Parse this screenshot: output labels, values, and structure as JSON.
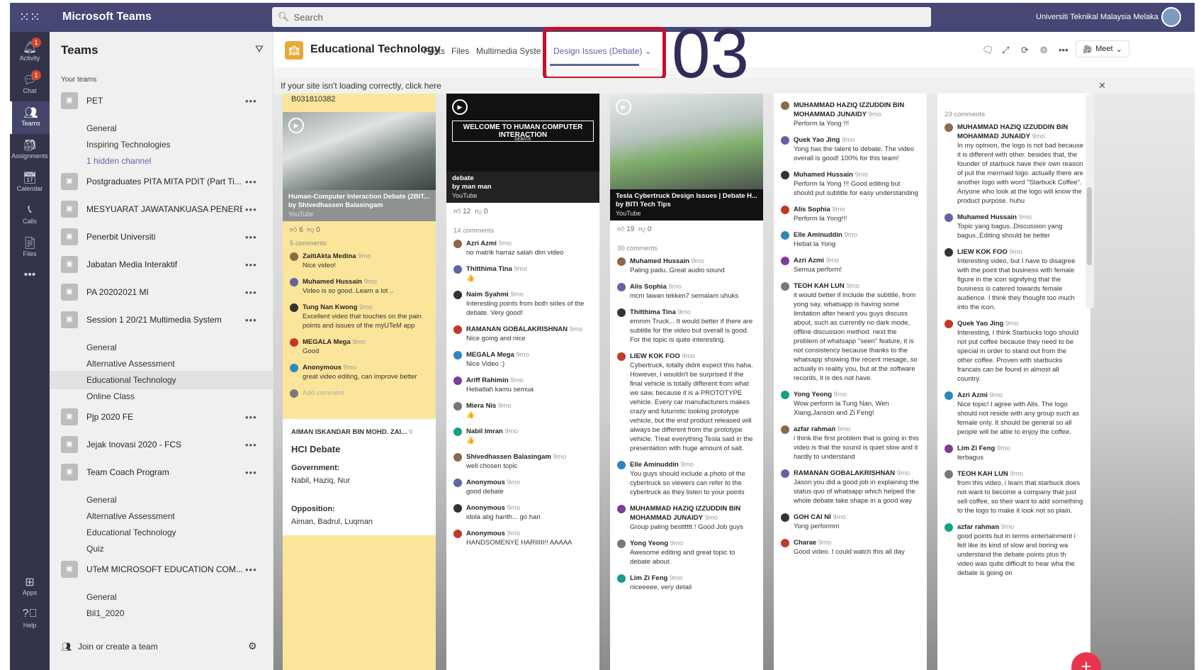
{
  "app": {
    "title": "Microsoft Teams",
    "org": "Universiti Teknikal Malaysia Melaka",
    "search_placeholder": "Search"
  },
  "rail": [
    {
      "label": "Activity",
      "badge": "1"
    },
    {
      "label": "Chat",
      "badge": "1"
    },
    {
      "label": "Teams",
      "badge": ""
    },
    {
      "label": "Assignments",
      "badge": ""
    },
    {
      "label": "Calendar",
      "badge": ""
    },
    {
      "label": "Calls",
      "badge": ""
    },
    {
      "label": "Files",
      "badge": ""
    },
    {
      "label": "Apps",
      "badge": ""
    },
    {
      "label": "Help",
      "badge": ""
    }
  ],
  "teams": {
    "header": "Teams",
    "your_teams": "Your teams",
    "join": "Join or create a team",
    "items": [
      {
        "name": "PET",
        "type": "team"
      },
      {
        "name": "General",
        "type": "channel"
      },
      {
        "name": "Inspiring Technologies",
        "type": "channel"
      },
      {
        "name": "1 hidden channel",
        "type": "hidden"
      },
      {
        "name": "Postgraduates PITA MITA PDIT (Part Ti...",
        "type": "team"
      },
      {
        "name": "MESYUARAT JAWATANKUASA PENERB...",
        "type": "team"
      },
      {
        "name": "Penerbit Universiti",
        "type": "team"
      },
      {
        "name": "Jabatan Media Interaktif",
        "type": "team"
      },
      {
        "name": "PA 20202021 MI",
        "type": "team"
      },
      {
        "name": "Session 1 20/21 Multimedia System",
        "type": "team"
      },
      {
        "name": "General",
        "type": "channel"
      },
      {
        "name": "Alternative Assessment",
        "type": "channel"
      },
      {
        "name": "Educational Technology",
        "type": "channel"
      },
      {
        "name": "Online Class",
        "type": "channel"
      },
      {
        "name": "Pjp 2020 FE",
        "type": "team"
      },
      {
        "name": "Jejak Inovasi 2020 - FCS",
        "type": "team"
      },
      {
        "name": "Team Coach Program",
        "type": "team"
      },
      {
        "name": "General",
        "type": "channel"
      },
      {
        "name": "Alternative Assessment",
        "type": "channel"
      },
      {
        "name": "Educational Technology",
        "type": "channel"
      },
      {
        "name": "Quiz",
        "type": "channel"
      },
      {
        "name": "UTeM MICROSOFT EDUCATION COM...",
        "type": "team"
      },
      {
        "name": "General",
        "type": "channel"
      },
      {
        "name": "Bil1_2020",
        "type": "channel"
      }
    ]
  },
  "channel": {
    "name": "Educational Technology",
    "tabs": [
      "Posts",
      "Files",
      "Multimedia Syste",
      "Design Issues (Debate)"
    ],
    "annotation": "03",
    "meet": "Meet",
    "notice": "If your site isn't loading correctly, click here"
  },
  "board": {
    "col1": {
      "top_text": "B031810382",
      "video_title": "Human-Computer Interaction Debate (2BIT...",
      "video_by": "by Shivedhassen Balasingam",
      "video_src": "YouTube",
      "likes": "6",
      "dislikes": "0",
      "comments_count": "5 comments",
      "comments": [
        {
          "name": "ZaitiAkta Medina",
          "time": "9mo",
          "text": "Nice video!"
        },
        {
          "name": "Muhamed Hussain",
          "time": "9mo",
          "text": "Video is so good..Learn a lot .."
        },
        {
          "name": "Tung Nan Kwong",
          "time": "9mo",
          "text": "Excellent video that touches on the pain points and issues of the myUTeM app"
        },
        {
          "name": "MEGALA Mega",
          "time": "9mo",
          "text": "Good"
        },
        {
          "name": "Anonymous",
          "time": "9mo",
          "text": "great video editing, can improve better"
        }
      ],
      "add_comment": "Add comment",
      "card_author": "AIMAN ISKANDAR BIN MOHD. ZAI...",
      "card_time": "9",
      "card_title": "HCI Debate",
      "gov_label": "Government:",
      "gov": "Nabil, Haziq, Nur",
      "opp_label": "Opposition:",
      "opp": "Aiman, Badrul, Luqman"
    },
    "col2": {
      "video_banner": "WELCOME TO HUMAN COMPUTER INTERACTION",
      "video_banner_sub": "DEBATE",
      "video_title": "debate",
      "video_by": "by man man",
      "video_src": "YouTube",
      "likes": "12",
      "dislikes": "0",
      "comments_count": "14 comments",
      "comments": [
        {
          "name": "Azri Azmi",
          "time": "9mo",
          "text": "no matrik harraz salah dlm video"
        },
        {
          "name": "Thitthima Tina",
          "time": "9mo",
          "text": "👍"
        },
        {
          "name": "Naim Syahmi",
          "time": "9mo",
          "text": "Interesting points from both sides of the debate. Very good!"
        },
        {
          "name": "RAMANAN GOBALAKRISHNAN",
          "time": "9mo",
          "text": "Nice going and nice"
        },
        {
          "name": "MEGALA Mega",
          "time": "9mo",
          "text": "Nice Video :)"
        },
        {
          "name": "Ariff Rahimin",
          "time": "9mo",
          "text": "Hebatlah kamu semua"
        },
        {
          "name": "Miera Nis",
          "time": "9mo",
          "text": "👍"
        },
        {
          "name": "Nabil Imran",
          "time": "9mo",
          "text": "👍"
        },
        {
          "name": "Shivedhassen Balasingam",
          "time": "9mo",
          "text": "well chosen topic"
        },
        {
          "name": "Anonymous",
          "time": "9mo",
          "text": "good debate"
        },
        {
          "name": "Anonymous",
          "time": "9mo",
          "text": "idola abg harith... go hari"
        },
        {
          "name": "Anonymous",
          "time": "9mo",
          "text": "HANDSOMENYE HARIIIII!! AAAAA"
        }
      ]
    },
    "col3": {
      "video_title": "Tesla Cybertruck Design Issues | Debate H...",
      "video_by": "by BITI Tech Tips",
      "video_src": "YouTube",
      "likes": "19",
      "dislikes": "0",
      "comments_count": "30 comments",
      "comments": [
        {
          "name": "Muhamed Hussain",
          "time": "9mo",
          "text": "Paling padu..Great audio sound"
        },
        {
          "name": "Alis Sophia",
          "time": "9mo",
          "text": "mcm lawan tekken7 semalam uhuks"
        },
        {
          "name": "Thitthima Tina",
          "time": "9mo",
          "text": "emmm Truck... It would better if there are subtitle for the video but overall is good. For the topic is quite interesting."
        },
        {
          "name": "LIEW KOK FOO",
          "time": "9mo",
          "text": "Cybertruck, totally didnt expect this haha. However, I wouldn't be surprised if the final vehicle is totally different from what we saw, because it is a PROTOTYPE vehicle. Every car manufacturers makes crazy and futuristic looking prototype vehicle, but the end product released will always be different from the prototype vehicle. Treat everything Tesla said in the presentation with huge amount of salt."
        },
        {
          "name": "Elle Aminuddin",
          "time": "9mo",
          "text": "You guys should include a photo of the cybertruck so viewers can refer to the cybertruck as they listen to your points"
        },
        {
          "name": "MUHAMMAD HAZIQ IZZUDDIN BIN MOHAMMAD JUNAIDY",
          "time": "9mo",
          "text": "Group paling bestttttt ! Good Job guys"
        },
        {
          "name": "Yong Yeong",
          "time": "9mo",
          "text": "Awesome editing and great topic to debate about."
        },
        {
          "name": "Lim Zi Feng",
          "time": "9mo",
          "text": "niceeeee, very detail"
        }
      ]
    },
    "col4": {
      "comments": [
        {
          "name": "MUHAMMAD HAZIQ IZZUDDIN BIN MOHAMMAD JUNAIDY",
          "time": "9mo",
          "text": "Perform la Yong !!!"
        },
        {
          "name": "Quek Yao Jing",
          "time": "9mo",
          "text": "Yong has the talent to debate. The video overall is good! 100% for this team!"
        },
        {
          "name": "Muhamed Hussain",
          "time": "9mo",
          "text": "Perform la Yong !!! Good editing but should put subtitle for easy understanding"
        },
        {
          "name": "Alis Sophia",
          "time": "9mo",
          "text": "Perform la Yong!!!"
        },
        {
          "name": "Elle Aminuddin",
          "time": "9mo",
          "text": "Hebat la Yong"
        },
        {
          "name": "Azri Azmi",
          "time": "9mo",
          "text": "Semua perform!"
        },
        {
          "name": "TEOH KAH LUN",
          "time": "9mo",
          "text": "it would better if include the subtitle, from yong say, whatsapp is having some limitation after heard you guys discuss about, such as currently no dark mode, offline discussion method. next the problem of whatsapp \"seen\" feature, it is not consistency because thanks to the whatsapp showing the recent mesage, so actually in reality you, but at the software records, it is des not have."
        },
        {
          "name": "Yong Yeong",
          "time": "9mo",
          "text": "Wow perform la Tung Nan, Wen Xiang,Janson and Zi Feng!"
        },
        {
          "name": "azfar rahman",
          "time": "9mo",
          "text": "i think the first problem that is going in this video is that the sound is quiet slow and it hardly to understand"
        },
        {
          "name": "RAMANAN GOBALAKRISHNAN",
          "time": "9mo",
          "text": "Jason you did a good job in explaining the status quo of whatsapp which helped the whole debate take shape in a good way"
        },
        {
          "name": "GOH CAI NI",
          "time": "9mo",
          "text": "Yong performm"
        },
        {
          "name": "Charae",
          "time": "9mo",
          "text": "Good video. I could watch this all day"
        }
      ]
    },
    "col5": {
      "comments_count": "23 comments",
      "comments": [
        {
          "name": "MUHAMMAD HAZIQ IZZUDDIN BIN MOHAMMAD JUNAIDY",
          "time": "9mo",
          "text": "In my opinion, the logo is not bad because it is different with other. besides that, the founder of starbuck have their own reason of put the mermaid logo. actually there are another logo with word \"Starbuck Coffee\". Anyone who look at the logo will know the product purpose. huhu"
        },
        {
          "name": "Muhamed Hussain",
          "time": "9mo",
          "text": "Topic yang bagus..Discussion yang bagus..Editing should be better"
        },
        {
          "name": "LIEW KOK FOO",
          "time": "9mo",
          "text": "Interesting video, but I have to disagree with the point that business with female figure in the icon signifying that the business is catered towards female audience. I think they thought too much into the icon."
        },
        {
          "name": "Quek Yao Jing",
          "time": "9mo",
          "text": "Interesting, I think Starbucks logo should not put coffee because they need to be special in order to stand out from the other coffee. Proven with starbucks francais can be found in almost all country."
        },
        {
          "name": "Azri Azmi",
          "time": "9mo",
          "text": "Nice topic! I agree with Alis. The logo should not reside with any group such as female only. It should be general so all people will be able to enjoy the coffee."
        },
        {
          "name": "Lim Zi Feng",
          "time": "9mo",
          "text": "terbagus"
        },
        {
          "name": "TEOH KAH LUN",
          "time": "9mo",
          "text": "from this video, i learn that starbuck does not want to become a company that just sell coffee, so their want to add something to the logo to make it look not so plain."
        },
        {
          "name": "azfar rahman",
          "time": "9mo",
          "text": "good points but in terms entertainment i felt like its kind of slow and boring wa understand the debate points plus th video was quite difficult to hear wha the debate is going on"
        }
      ]
    }
  }
}
